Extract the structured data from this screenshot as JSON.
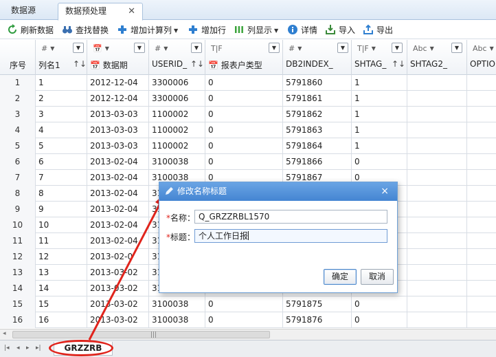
{
  "tabs": [
    {
      "label": "数据源"
    },
    {
      "label": "数据预处理",
      "close": "✕"
    }
  ],
  "toolbar": {
    "refresh": "刷新数据",
    "find_replace": "查找替换",
    "add_calc_col": "增加计算列",
    "add_row": "增加行",
    "col_display": "列显示",
    "details": "详情",
    "import": "导入",
    "export": "导出"
  },
  "columns": [
    {
      "type": "#",
      "title": "序号"
    },
    {
      "type": "#",
      "title": "列名1"
    },
    {
      "type": "date",
      "title": "数据期"
    },
    {
      "type": "#",
      "title": "USERID_"
    },
    {
      "type": "T|F",
      "title": "报表户类型"
    },
    {
      "type": "#",
      "title": "DB2INDEX_"
    },
    {
      "type": "T|F",
      "title": "SHTAG_"
    },
    {
      "type": "Abc",
      "title": "SHTAG2_"
    },
    {
      "type": "Abc",
      "title": "OPTIO"
    }
  ],
  "rows": [
    [
      "1",
      "1",
      "2012-12-04",
      "3300006",
      "0",
      "5791860",
      "1"
    ],
    [
      "2",
      "2",
      "2012-12-04",
      "3300006",
      "0",
      "5791861",
      "1"
    ],
    [
      "3",
      "3",
      "2013-03-03",
      "1100002",
      "0",
      "5791862",
      "1"
    ],
    [
      "4",
      "4",
      "2013-03-03",
      "1100002",
      "0",
      "5791863",
      "1"
    ],
    [
      "5",
      "5",
      "2013-03-03",
      "1100002",
      "0",
      "5791864",
      "1"
    ],
    [
      "6",
      "6",
      "2013-02-04",
      "3100038",
      "0",
      "5791866",
      "0"
    ],
    [
      "7",
      "7",
      "2013-02-04",
      "3100038",
      "0",
      "5791867",
      "0"
    ],
    [
      "8",
      "8",
      "2013-02-04",
      "31",
      "",
      "",
      ""
    ],
    [
      "9",
      "9",
      "2013-02-04",
      "31",
      "",
      "",
      ""
    ],
    [
      "10",
      "10",
      "2013-02-04",
      "31",
      "",
      "",
      ""
    ],
    [
      "11",
      "11",
      "2013-02-04",
      "31",
      "",
      "",
      ""
    ],
    [
      "12",
      "12",
      "2013-02-0",
      "31",
      "",
      "",
      ""
    ],
    [
      "13",
      "13",
      "2013-03-02",
      "31",
      "",
      "",
      ""
    ],
    [
      "14",
      "14",
      "2013-03-02",
      "31",
      "",
      "",
      ""
    ],
    [
      "15",
      "15",
      "2013-03-02",
      "3100038",
      "0",
      "5791875",
      "0"
    ],
    [
      "16",
      "16",
      "2013-03-02",
      "3100038",
      "0",
      "5791876",
      "0"
    ]
  ],
  "sheet_tab": "GRZZRB",
  "dialog": {
    "title": "修改名称标题",
    "close": "×",
    "name_label": "名称：",
    "name_value": "Q_GRZZRBL1570",
    "title_label": "标题：",
    "title_value": "个人工作日报",
    "required_mark": "*",
    "ok": "确定",
    "cancel": "取消"
  },
  "colors": {
    "annotation": "#e0241c",
    "dialog_header": "#4a8bd6"
  }
}
